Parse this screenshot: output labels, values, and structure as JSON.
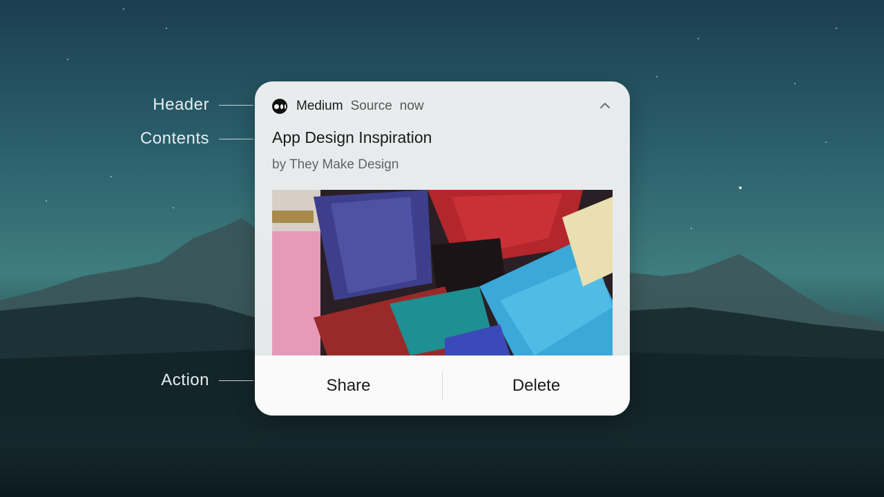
{
  "callouts": {
    "header": "Header",
    "contents": "Contents",
    "action": "Action"
  },
  "notification": {
    "app_name": "Medium",
    "source": "Source",
    "time": "now",
    "title": "App Design Inspiration",
    "subtitle": "by They Make Design",
    "image_icon": "paint-brushes-photo",
    "collapse_icon": "chevron-up-icon",
    "actions": {
      "share": "Share",
      "delete": "Delete"
    }
  }
}
